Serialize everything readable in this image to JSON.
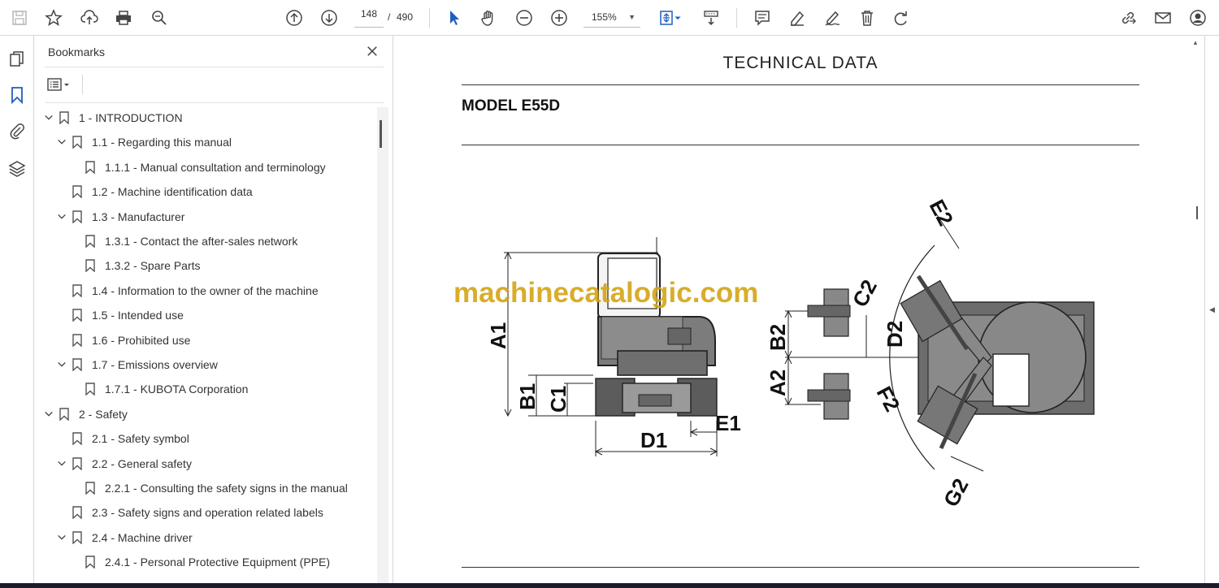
{
  "toolbar": {
    "page_current": "148",
    "page_separator": "/",
    "page_total": "490",
    "zoom": "155%"
  },
  "bookmarks": {
    "title": "Bookmarks",
    "items": [
      {
        "label": "1  -  INTRODUCTION",
        "level": 0,
        "expanded": true
      },
      {
        "label": "1.1 - Regarding this manual",
        "level": 1,
        "expanded": true
      },
      {
        "label": "1.1.1 - Manual consultation and terminology",
        "level": 2
      },
      {
        "label": "1.2 - Machine identification data",
        "level": 1
      },
      {
        "label": "1.3 - Manufacturer",
        "level": 1,
        "expanded": true
      },
      {
        "label": "1.3.1 - Contact the after-sales network",
        "level": 2
      },
      {
        "label": "1.3.2 - Spare Parts",
        "level": 2
      },
      {
        "label": "1.4 - Information to the owner of the machine",
        "level": 1
      },
      {
        "label": "1.5 - Intended use",
        "level": 1
      },
      {
        "label": "1.6 - Prohibited use",
        "level": 1
      },
      {
        "label": "1.7 - Emissions overview",
        "level": 1,
        "expanded": true
      },
      {
        "label": "1.7.1 - KUBOTA Corporation",
        "level": 2
      },
      {
        "label": "2  -  Safety",
        "level": 0,
        "expanded": true
      },
      {
        "label": "2.1 - Safety symbol",
        "level": 1
      },
      {
        "label": "2.2 - General safety",
        "level": 1,
        "expanded": true
      },
      {
        "label": "2.2.1 - Consulting the safety signs in the manual",
        "level": 2
      },
      {
        "label": "2.3 - Safety signs and operation related labels",
        "level": 1
      },
      {
        "label": "2.4 - Machine driver",
        "level": 1,
        "expanded": true
      },
      {
        "label": "2.4.1 - Personal Protective Equipment (PPE)",
        "level": 2
      }
    ]
  },
  "document": {
    "title": "TECHNICAL DATA",
    "model": "MODEL E55D",
    "watermark": "machinecatalogic.com",
    "dimension_labels": {
      "A1": "A1",
      "B1": "B1",
      "C1": "C1",
      "D1": "D1",
      "E1": "E1",
      "A2": "A2",
      "B2": "B2",
      "C2": "C2",
      "D2": "D2",
      "E2": "E2",
      "F2": "F2",
      "G2": "G2"
    }
  }
}
